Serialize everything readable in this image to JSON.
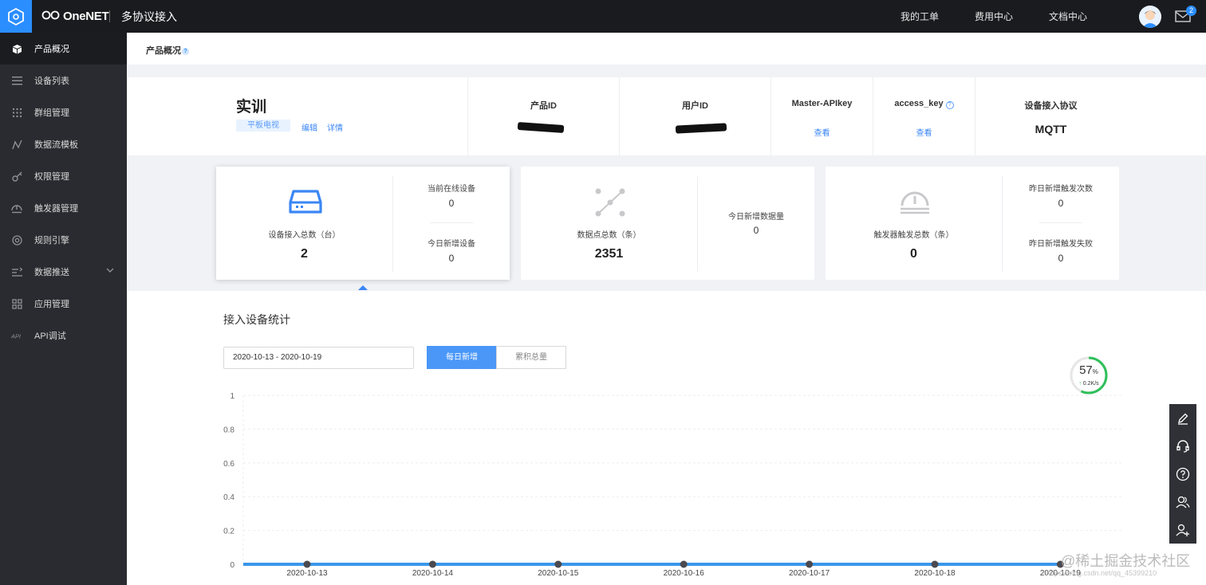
{
  "header": {
    "brand": "OneNET",
    "app_title": "多协议接入",
    "nav": [
      "我的工单",
      "费用中心",
      "文档中心"
    ],
    "mail_count": "2",
    "icons": {
      "logo": "hexagon-logo-icon",
      "mail": "mail-icon",
      "avatar": "user-avatar"
    }
  },
  "sidebar": {
    "items": [
      {
        "label": "产品概况",
        "icon": "cube-icon",
        "active": true
      },
      {
        "label": "设备列表",
        "icon": "list-icon"
      },
      {
        "label": "群组管理",
        "icon": "grid-dots-icon"
      },
      {
        "label": "数据流模板",
        "icon": "wave-icon"
      },
      {
        "label": "权限管理",
        "icon": "key-icon"
      },
      {
        "label": "触发器管理",
        "icon": "trigger-icon"
      },
      {
        "label": "规则引擎",
        "icon": "target-icon"
      },
      {
        "label": "数据推送",
        "icon": "push-icon",
        "expandable": true
      },
      {
        "label": "应用管理",
        "icon": "apps-icon"
      },
      {
        "label": "API调试",
        "icon": "api-icon"
      }
    ]
  },
  "breadcrumb": {
    "label": "产品概况",
    "help": "?"
  },
  "product": {
    "name": "实训",
    "tag": "平板电视",
    "edit": "编辑",
    "details": "详情",
    "product_id_label": "产品ID",
    "user_id_label": "用户ID",
    "master_apikey_label": "Master-APIkey",
    "master_apikey_action": "查看",
    "access_key_label": "access_key",
    "access_key_action": "查看",
    "protocol_label": "设备接入协议",
    "protocol_value": "MQTT"
  },
  "stats": {
    "devices": {
      "label": "设备接入总数（台）",
      "value": "2",
      "online_label": "当前在线设备",
      "online_value": "0",
      "new_label": "今日新增设备",
      "new_value": "0"
    },
    "datapoints": {
      "label": "数据点总数（条）",
      "value": "2351",
      "today_label": "今日新增数据量",
      "today_value": "0"
    },
    "triggers": {
      "label": "触发器触发总数（条）",
      "value": "0",
      "yesterday_label": "昨日新增触发次数",
      "yesterday_value": "0",
      "failed_label": "昨日新增触发失败",
      "failed_value": "0"
    }
  },
  "section": {
    "title": "接入设备统计",
    "date_range": "2020-10-13 - 2020-10-19",
    "tab_daily": "每日新增",
    "tab_total": "累积总量"
  },
  "gauge": {
    "percent": "57",
    "percent_unit": "%",
    "speed": "0.2K/s",
    "speed_arrow": "↑",
    "fraction": 0.57
  },
  "floatbar": {
    "icons": [
      "edit-icon",
      "headset-icon",
      "help-icon",
      "users-icon",
      "add-user-icon"
    ]
  },
  "watermark": {
    "text": "@稀土掘金技术社区",
    "url": "https://blog.csdn.net/qq_45399210"
  },
  "colors": {
    "accent": "#4a97f8",
    "line": "#3a97ea",
    "sidebar": "#2a2b30",
    "topbar": "#1a1b1f"
  },
  "chart_data": {
    "type": "line",
    "x": [
      "2020-10-13",
      "2020-10-14",
      "2020-10-15",
      "2020-10-16",
      "2020-10-17",
      "2020-10-18",
      "2020-10-19"
    ],
    "values": [
      0,
      0,
      0,
      0,
      0,
      0,
      0
    ],
    "ylim": [
      0,
      1
    ],
    "yticks": [
      "0",
      "0.2",
      "0.4",
      "0.6",
      "0.8",
      "1"
    ],
    "grid": true
  }
}
